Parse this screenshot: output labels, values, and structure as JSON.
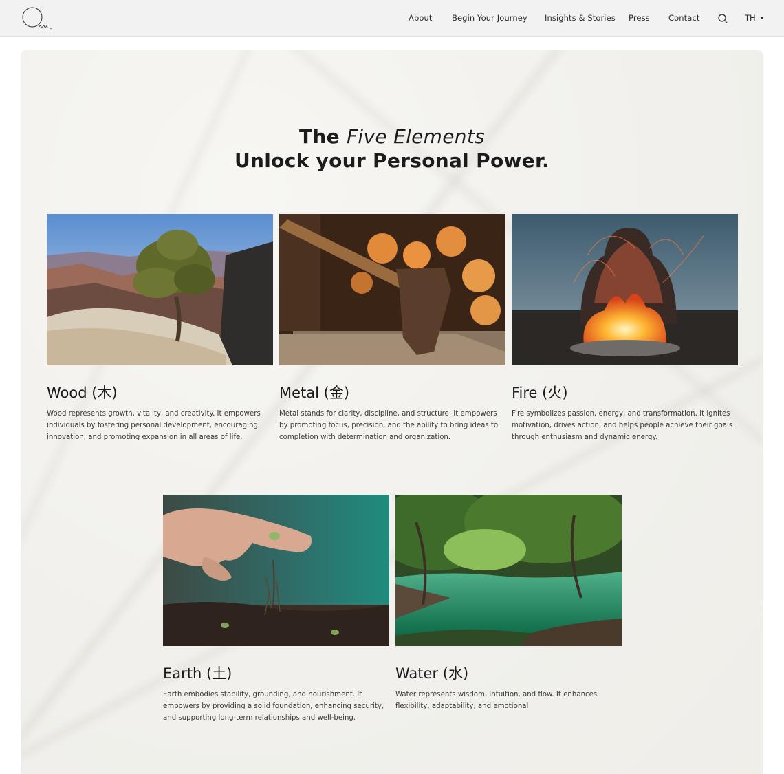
{
  "nav": {
    "logo_text": "Om.",
    "links": [
      "About",
      "Begin Your Journey",
      "Insights & Stories",
      "Press",
      "Contact"
    ],
    "search_icon": "search-icon",
    "language": "TH"
  },
  "hero": {
    "title_prefix": "The",
    "title_emphasis": "Five Elements",
    "subtitle": "Unlock your Personal Power."
  },
  "elements": [
    {
      "title": "Wood (木)",
      "description": "Wood represents growth, vitality, and creativity. It empowers individuals by fostering personal development, encouraging innovation, and promoting expansion in all areas of life."
    },
    {
      "title": "Metal (金)",
      "description": "Metal stands for clarity, discipline, and structure. It empowers by promoting focus, precision, and the ability to bring ideas to completion with determination and organization."
    },
    {
      "title": "Fire (火)",
      "description": "Fire symbolizes passion, energy, and transformation. It ignites motivation, drives action, and helps people achieve their goals through enthusiasm and dynamic energy."
    },
    {
      "title": "Earth (土)",
      "description": "Earth embodies stability, grounding, and nourishment. It empowers by providing a solid foundation, enhancing security, and supporting long-term relationships and well-being."
    },
    {
      "title": "Water (水)",
      "description": "Water represents wisdom, intuition, and flow. It enhances flexibility, adaptability, and emotional"
    }
  ]
}
